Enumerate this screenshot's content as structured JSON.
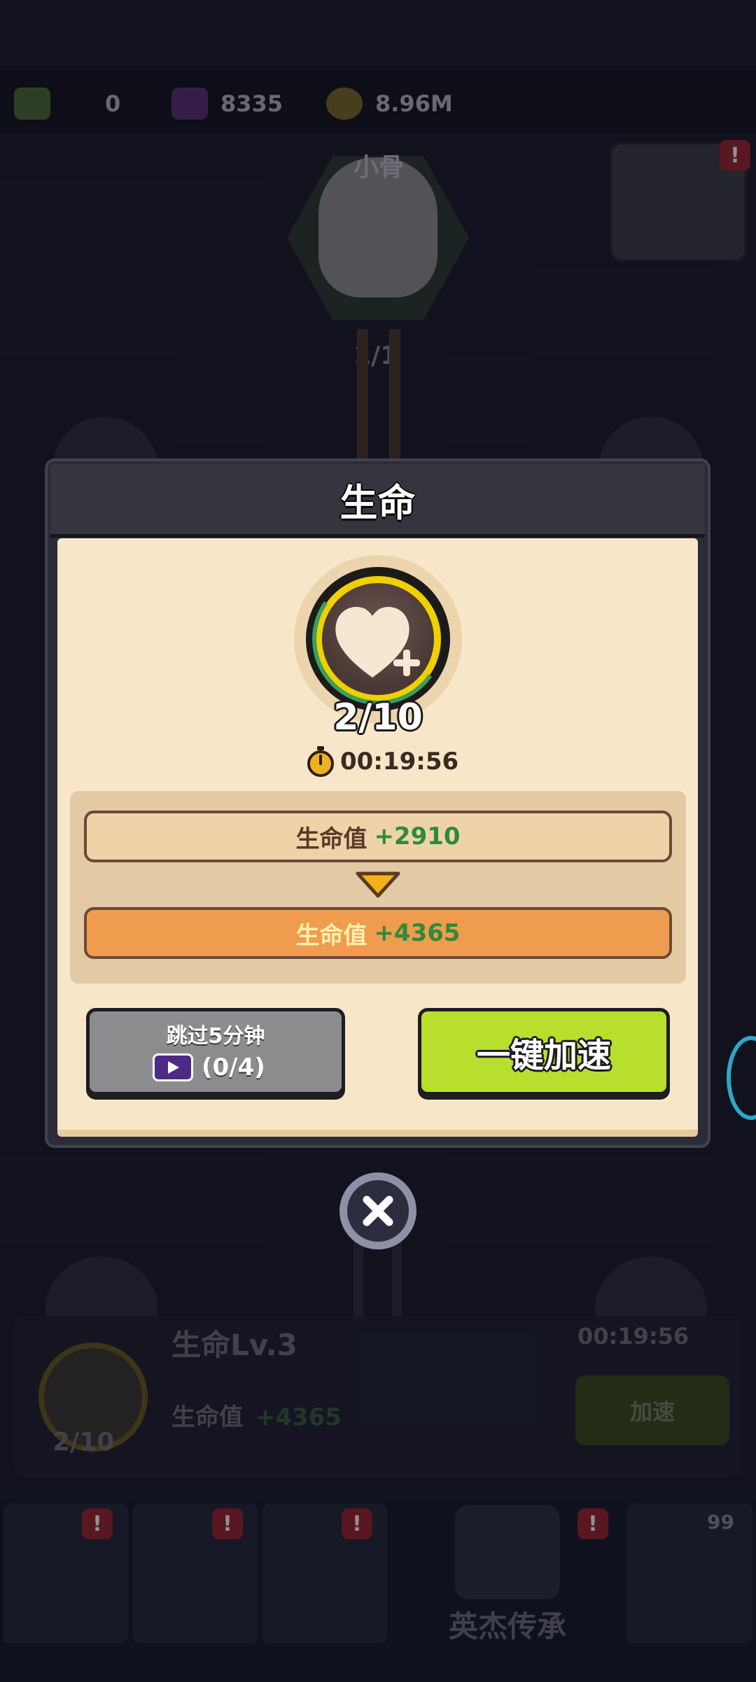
{
  "resources": {
    "tickets": "0",
    "gems": "8335",
    "coins": "8.96M"
  },
  "hero": {
    "name": "小骨",
    "count": "1/1"
  },
  "dialog": {
    "title": "生命",
    "level_progress": "2/10",
    "timer": "00:19:56",
    "current_stat_label": "生命值",
    "current_stat_value": "+2910",
    "next_stat_label": "生命值",
    "next_stat_value": "+4365",
    "skip_label": "跳过5分钟",
    "skip_count": "(0/4)",
    "speed_label": "一键加速"
  },
  "info_strip": {
    "title": "生命Lv.3",
    "timer": "00:19:56",
    "stat_label": "生命值",
    "stat_value": "+4365",
    "level_progress": "2/10",
    "speed_label": "加速"
  },
  "nav": {
    "badge_1": "!",
    "badge_2": "!",
    "badge_3": "!",
    "badge_5": "!",
    "chest_count": "99",
    "center_label": "英杰传承"
  },
  "corner_badge": "!",
  "colors": {
    "accent_green": "#b8de2e",
    "stat_plus": "#2f8a3a",
    "next_row": "#f09c4e",
    "parchment": "#f8e6c8"
  }
}
